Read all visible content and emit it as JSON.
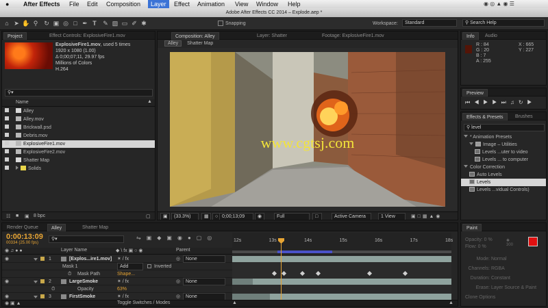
{
  "menubar": {
    "apple_icon": "apple-icon",
    "items": [
      "After Effects",
      "File",
      "Edit",
      "Composition",
      "Layer",
      "Effect",
      "Animation",
      "View",
      "Window",
      "Help"
    ],
    "status_right": "Search Help"
  },
  "titlebar": {
    "title": "Adobe After Effects CC 2014 – Explode.aep *"
  },
  "toolbar": {
    "snapping_label": "Snapping",
    "workspace_label": "Workspace:",
    "workspace_value": "Standard",
    "search_placeholder": "Search Help"
  },
  "project": {
    "tab_project": "Project",
    "tab_effect_controls": "Effect Controls: ExplosiveFire1.mov",
    "footage_name": "ExplosiveFire1.mov",
    "footage_used": ", used 5 times",
    "footage_dims": "1920 x 1080 (1.00)",
    "footage_duration": "Δ 0;00;07;11, 29.97 fps",
    "footage_colors": "Millions of Colors",
    "footage_codec": "H.264",
    "column_name": "Name",
    "items": [
      {
        "name": "Alley",
        "type": "comp",
        "color": "#d9d9d9"
      },
      {
        "name": "Alley.mov",
        "type": "footage",
        "color": "#b8b8b8"
      },
      {
        "name": "Brickwall.psd",
        "type": "footage",
        "color": "#b8b8b8"
      },
      {
        "name": "Debris.mov",
        "type": "footage",
        "color": "#b8b8b8"
      },
      {
        "name": "ExplosiveFire1.mov",
        "type": "footage",
        "color": "#b8b8b8",
        "selected": true
      },
      {
        "name": "ExplosiveFire2.mov",
        "type": "footage",
        "color": "#b8b8b8"
      },
      {
        "name": "Shatter Map",
        "type": "comp",
        "color": "#d9d9d9"
      },
      {
        "name": "Solids",
        "type": "folder",
        "color": "#e8d54a"
      }
    ],
    "bpc": "8 bpc"
  },
  "comp": {
    "tab_comp": "Composition: Alley",
    "tab_layer": "Layer: Shatter",
    "tab_footage": "Footage: ExplosiveFire1.mov",
    "crumb_1": "Alley",
    "crumb_2": "Shatter Map",
    "watermark": "www.cgtsj.com",
    "zoom": "(33.3%)",
    "timecode": "0;00;13;09",
    "resolution": "Full",
    "camera": "Active Camera",
    "view": "1 View"
  },
  "info": {
    "tab_info": "Info",
    "tab_audio": "Audio",
    "r": "R : 84",
    "g": "G : 20",
    "b": "B : 7",
    "a": "A : 255",
    "x": "X : 665",
    "y": "Y : 227",
    "swatch_color": "#541407"
  },
  "preview": {
    "tab": "Preview"
  },
  "effects": {
    "tab": "Effects & Presets",
    "tab_brushes": "Brushes",
    "search_value": "level",
    "tree": [
      {
        "label": "* Animation Presets",
        "indent": 0,
        "kind": "group"
      },
      {
        "label": "Image – Utilities",
        "indent": 1,
        "kind": "folder"
      },
      {
        "label": "Levels ...uter to video",
        "indent": 2,
        "kind": "preset"
      },
      {
        "label": "Levels ... to computer",
        "indent": 2,
        "kind": "preset"
      },
      {
        "label": "Color Correction",
        "indent": 0,
        "kind": "group"
      },
      {
        "label": "Auto Levels",
        "indent": 1,
        "kind": "effect"
      },
      {
        "label": "Levels",
        "indent": 1,
        "kind": "effect",
        "selected": true
      },
      {
        "label": "Levels ...vidual Controls)",
        "indent": 1,
        "kind": "effect"
      }
    ]
  },
  "timeline": {
    "tab_render": "Render Queue",
    "tab_alley": "Alley",
    "tab_shatter": "Shatter Map",
    "timecode": "0:00:13:09",
    "frames": "00334 (25.00 fps)",
    "col_layer_name": "Layer Name",
    "col_parent": "Parent",
    "ruler": [
      "12s",
      "13s",
      "14s",
      "15s",
      "16s",
      "17s",
      "18s"
    ],
    "toggle_label": "Toggle Switches / Modes",
    "layers": [
      {
        "num": "1",
        "name": "[Explos...ire1.mov]",
        "parent": "None",
        "color": "#c8a84a"
      },
      {
        "num": "",
        "name": "Mask 1",
        "mode": "Add",
        "inverted": "Inverted"
      },
      {
        "num": "",
        "name": "Mask Path",
        "value": "Shape..."
      },
      {
        "num": "2",
        "name": "LargeSmoke",
        "parent": "None",
        "color": "#c8a84a"
      },
      {
        "num": "",
        "name": "Opacity",
        "value": "63%"
      },
      {
        "num": "3",
        "name": "FirstSmoke",
        "parent": "None",
        "color": "#c8a84a"
      }
    ]
  },
  "paint": {
    "tab": "Paint",
    "opacity": "Opacity: 0 %",
    "flow": "Flow: 0 %",
    "brush_size": "300",
    "mode_label": "Mode:",
    "mode_value": "Normal",
    "channels_label": "Channels:",
    "channels_value": "RGBA",
    "duration_label": "Duration:",
    "duration_value": "Constant",
    "erase_label": "Erase:",
    "erase_value": "Layer Source & Paint",
    "clone_label": "Clone Options",
    "fg_color": "#e01010"
  }
}
